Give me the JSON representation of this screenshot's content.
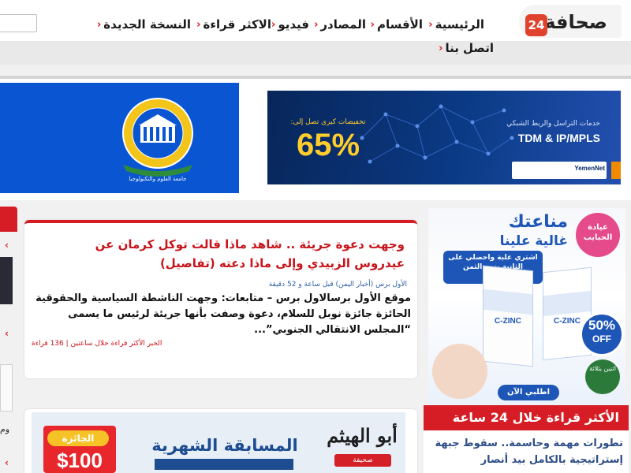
{
  "header": {
    "logo_text": "صحافة",
    "logo_badge": "24",
    "nav_items": [
      {
        "label": "الرئيسية"
      },
      {
        "label": "الأقسام"
      },
      {
        "label": "المصادر"
      },
      {
        "label": "فيديو"
      },
      {
        "label": "الاكثر قراءة"
      },
      {
        "label": "النسخة الجديدة"
      }
    ],
    "nav_row2": [
      {
        "label": "اتصل بنا"
      }
    ]
  },
  "banners": {
    "telecom": {
      "small_text": "خدمات التراسل والربط الشبكي",
      "product": "TDM & IP/MPLS",
      "discount_label": "تخفيضات كبرى تصل إلى:",
      "discount_value": "65%",
      "brand": "YemenNet"
    },
    "university": {
      "name": "جامعة العلوم والتكنولوجيا"
    }
  },
  "article": {
    "title": "وجهت دعوة جريئة .. شاهد ماذا قالت توكل كرمان عن عيدروس الزبيدي وإلى ماذا دعته (تفاصيل)",
    "meta": "الأول برس (أخبار اليمن) قبل ساعة و 52 دقيقة",
    "excerpt": "موقع الأول برسالاول برس – متابعات: وجهت الناشطة السياسية والحقوقية الحائزة جائزة نوبل للسلام، دعوة وصفت بأنها جريئة لرئيس ما يسمى “المجلس الانتقالي الجنوبي”...",
    "footer": "الخبر الأكثر قراءة خلال ساعتين | 136 قراءة"
  },
  "competition": {
    "prize_label": "الجائزة",
    "prize_amount": "$100",
    "title": "المسابقة الشهرية",
    "logo_text": "أبو الهيثم",
    "logo_sub": "صحيفة"
  },
  "pharma_ad": {
    "headline1": "مناعتك",
    "headline2": "غالية علينا",
    "subline": "اشتري علبة واحصلي على الثانية بنص الثمن",
    "brand": "عيادة الحبايب",
    "product": "C-ZINC",
    "offer_pct": "50%",
    "offer_word": "OFF",
    "badge": "اثنين بثلاثة",
    "cta": "اطلبي الآن"
  },
  "most_read": {
    "title": "الأكثر قراءة خلال 24 ساعة",
    "items": [
      "تطورات مهمة وحاسمة.. سقوط جبهة إستراتيجية بالكامل بيد أنصار"
    ]
  },
  "left_column": {
    "partial_text": "وم"
  },
  "colors": {
    "accent_red": "#d61d25",
    "title_red": "#c8141b",
    "link_blue": "#2c4d86",
    "meta_blue": "#2c5ea8"
  }
}
